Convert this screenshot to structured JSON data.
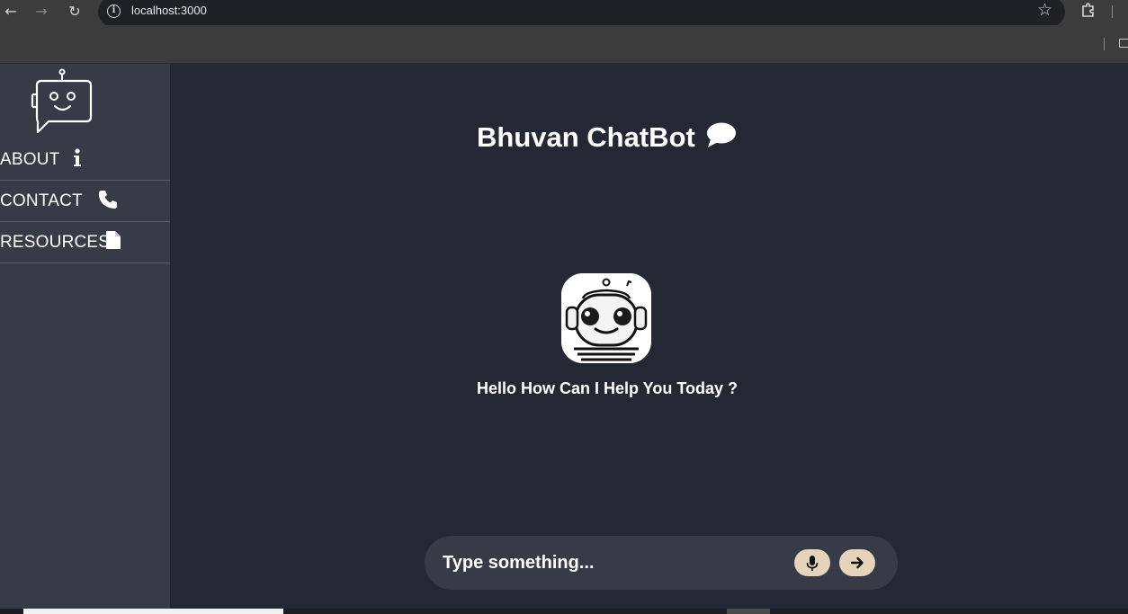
{
  "browser": {
    "url": "localhost:3000"
  },
  "sidebar": {
    "items": [
      {
        "label": "ABOUT",
        "icon": "info-icon"
      },
      {
        "label": "CONTACT",
        "icon": "phone-icon"
      },
      {
        "label": "RESOURCES",
        "icon": "document-icon"
      }
    ]
  },
  "main": {
    "title": "Bhuvan ChatBot",
    "greeting": "Hello How Can I Help You Today ?",
    "input_placeholder": "Type something..."
  },
  "colors": {
    "sidebar_bg": "#363b47",
    "main_bg": "#232834",
    "button_bg": "#e5d3bb"
  }
}
